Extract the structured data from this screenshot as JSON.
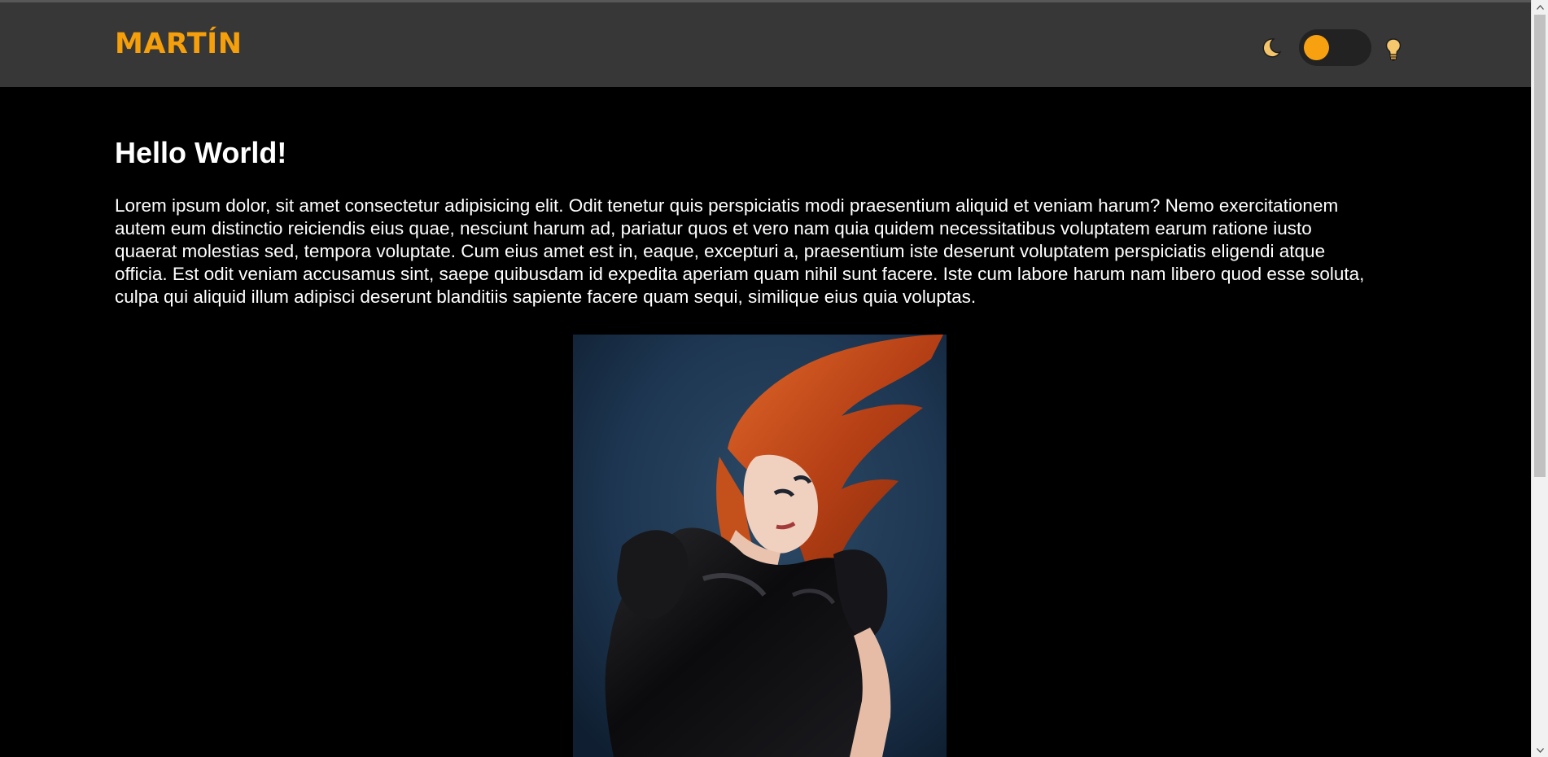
{
  "header": {
    "brand": "MARTÍN",
    "theme_toggle": {
      "dark_icon": "moon-icon",
      "light_icon": "lightbulb-icon",
      "state": "dark"
    }
  },
  "main": {
    "title": "Hello World!",
    "body": "Lorem ipsum dolor, sit amet consectetur adipisicing elit. Odit tenetur quis perspiciatis modi praesentium aliquid et veniam harum? Nemo exercitationem autem eum distinctio reiciendis eius quae, nesciunt harum ad, pariatur quos et vero nam quia quidem necessitatibus voluptatem earum ratione iusto quaerat molestias sed, tempora voluptate. Cum eius amet est in, eaque, excepturi a, praesentium iste deserunt voluptatem perspiciatis eligendi atque officia. Est odit veniam accusamus sint, saepe quibusdam id expedita aperiam quam nihil sunt facere. Iste cum labore harum nam libero quod esse soluta, culpa qui aliquid illum adipisci deserunt blanditiis sapiente facere quam sequi, similique eius quia voluptas."
  },
  "colors": {
    "accent": "#f59f0a",
    "navbar_bg": "#373737",
    "page_bg": "#000000",
    "text": "#ffffff"
  }
}
